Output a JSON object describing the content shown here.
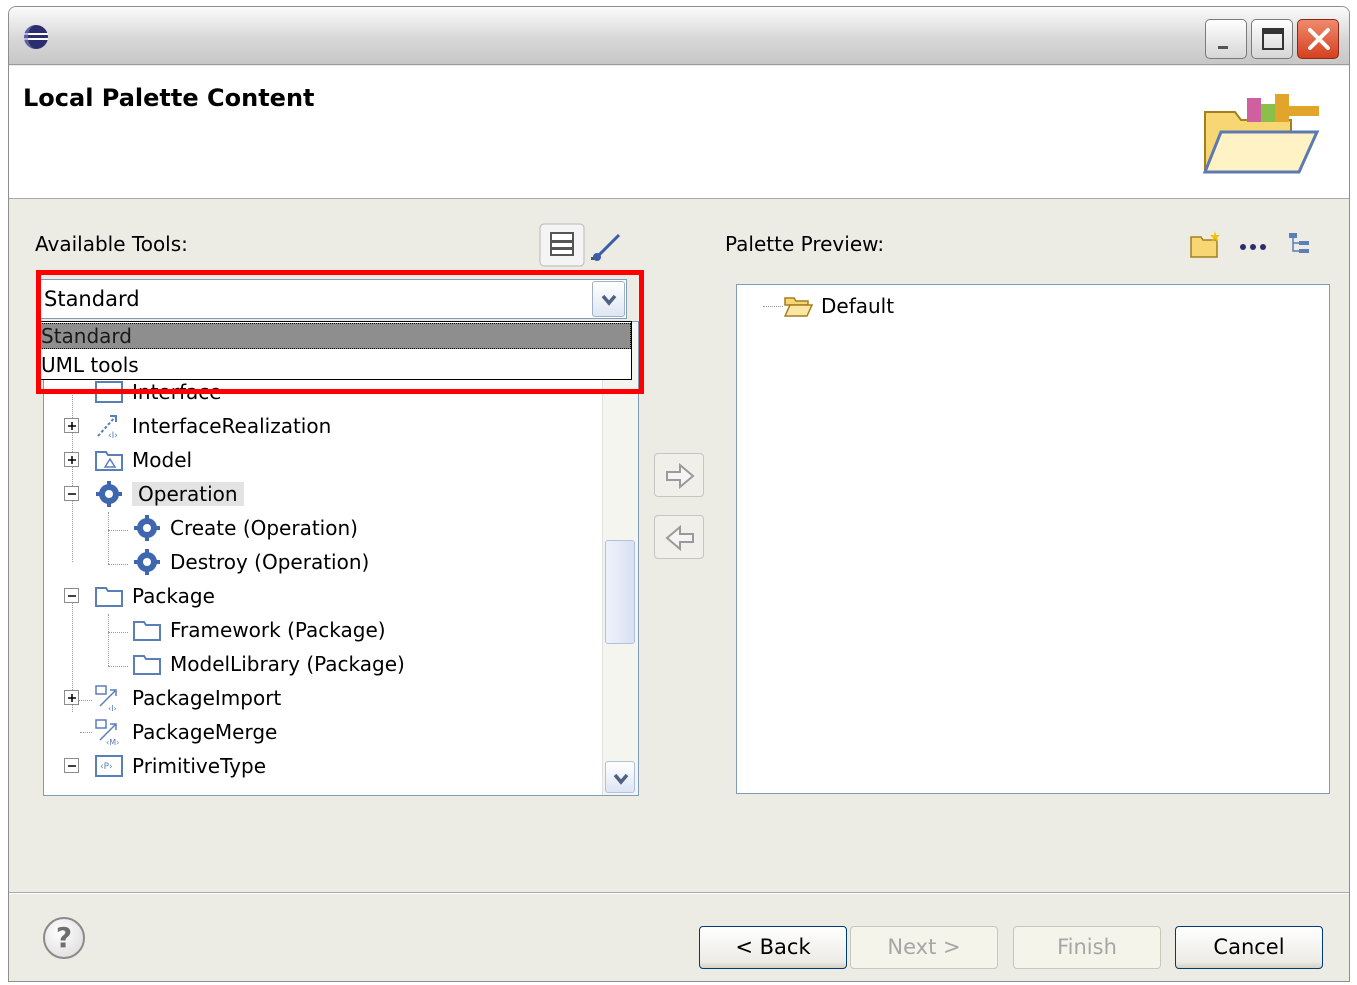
{
  "window": {
    "title": "",
    "header_title": "Local Palette Content"
  },
  "available_tools": {
    "label": "Available Tools:",
    "combo_value": "Standard",
    "dropdown_options": [
      "Standard",
      "UML tools"
    ],
    "selected_option": "Standard",
    "tree": [
      {
        "label": "Interface",
        "expanded": false,
        "icon": "interface-icon",
        "partially_hidden": true
      },
      {
        "label": "InterfaceRealization",
        "expanded": false,
        "icon": "interface-realization-icon"
      },
      {
        "label": "Model",
        "expanded": false,
        "icon": "model-icon"
      },
      {
        "label": "Operation",
        "expanded": true,
        "icon": "operation-gear-icon",
        "selected": true,
        "children": [
          "Create (Operation)",
          "Destroy (Operation)"
        ]
      },
      {
        "label": "Package",
        "expanded": true,
        "icon": "package-folder-icon",
        "children": [
          "Framework (Package)",
          "ModelLibrary (Package)"
        ]
      },
      {
        "label": "PackageImport",
        "expanded": false,
        "icon": "package-import-icon"
      },
      {
        "label": "PackageMerge",
        "icon": "package-merge-icon"
      },
      {
        "label": "PrimitiveType",
        "expanded": true,
        "icon": "primitive-type-icon"
      }
    ]
  },
  "palette_preview": {
    "label": "Palette Preview:",
    "root": "Default"
  },
  "buttons": {
    "back": "< Back",
    "next": "Next >",
    "finish": "Finish",
    "cancel": "Cancel"
  },
  "colors": {
    "highlight": "#ff0000",
    "selection": "#8e8e8e"
  }
}
